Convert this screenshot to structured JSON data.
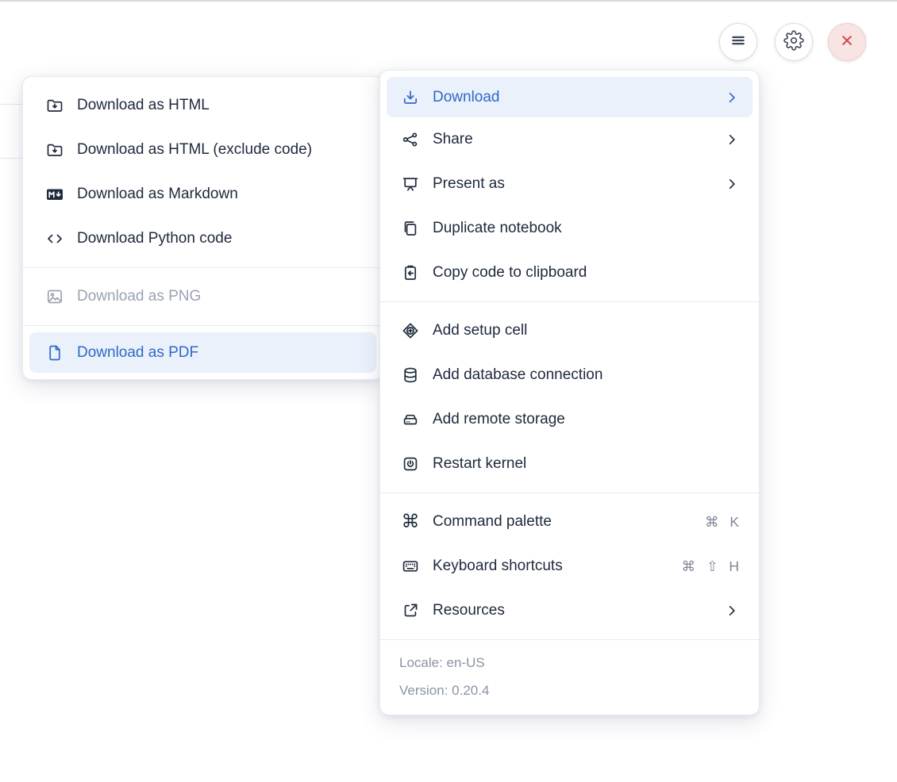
{
  "colors": {
    "accent_blue": "#2F69C8",
    "highlight_bg": "#EAF1FB",
    "text_dark": "#202B3D",
    "text_disabled": "#9AA3B2",
    "text_muted": "#8A93A4",
    "danger_red": "#D4474E",
    "danger_bg": "#F9E4E4"
  },
  "header": {
    "buttons": [
      {
        "name": "menu",
        "icon": "hamburger-icon"
      },
      {
        "name": "settings",
        "icon": "gear-icon"
      },
      {
        "name": "close",
        "icon": "close-icon"
      }
    ]
  },
  "download_submenu": {
    "items": [
      {
        "label": "Download as HTML",
        "icon": "folder-download-icon",
        "state": "normal"
      },
      {
        "label": "Download as HTML (exclude code)",
        "icon": "folder-download-icon",
        "state": "normal"
      },
      {
        "label": "Download as Markdown",
        "icon": "markdown-icon",
        "state": "normal"
      },
      {
        "label": "Download Python code",
        "icon": "code-icon",
        "state": "normal"
      },
      {
        "label": "Download as PNG",
        "icon": "image-icon",
        "state": "disabled"
      },
      {
        "label": "Download as PDF",
        "icon": "file-icon",
        "state": "highlighted"
      }
    ]
  },
  "main_menu": {
    "items": [
      {
        "label": "Download",
        "icon": "download-icon",
        "trailing": "chevron",
        "state": "highlighted"
      },
      {
        "label": "Share",
        "icon": "share-icon",
        "trailing": "chevron",
        "state": "normal"
      },
      {
        "label": "Present as",
        "icon": "presentation-icon",
        "trailing": "chevron",
        "state": "normal"
      },
      {
        "label": "Duplicate notebook",
        "icon": "duplicate-icon",
        "state": "normal"
      },
      {
        "label": "Copy code to clipboard",
        "icon": "clipboard-arrow-icon",
        "state": "normal"
      },
      {
        "label": "Add setup cell",
        "icon": "diamond-plus-icon",
        "state": "normal"
      },
      {
        "label": "Add database connection",
        "icon": "database-icon",
        "state": "normal"
      },
      {
        "label": "Add remote storage",
        "icon": "storage-icon",
        "state": "normal"
      },
      {
        "label": "Restart kernel",
        "icon": "power-icon",
        "state": "normal"
      },
      {
        "label": "Command palette",
        "icon": "command-icon",
        "shortcut": "⌘ K",
        "state": "normal"
      },
      {
        "label": "Keyboard shortcuts",
        "icon": "keyboard-icon",
        "shortcut": "⌘ ⇧ H",
        "state": "normal"
      },
      {
        "label": "Resources",
        "icon": "external-link-icon",
        "trailing": "chevron",
        "state": "normal"
      }
    ],
    "footer": {
      "locale": "Locale: en-US",
      "version": "Version: 0.20.4"
    }
  }
}
